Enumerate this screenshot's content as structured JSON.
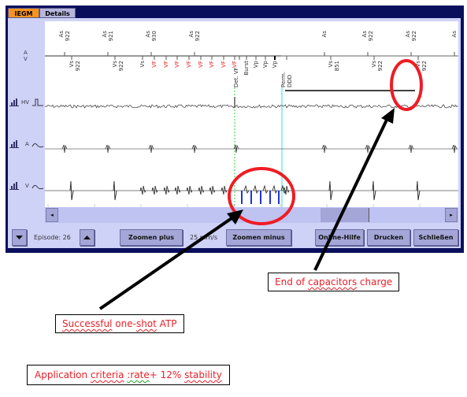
{
  "tabs": [
    {
      "label": "IEGM",
      "active": true
    },
    {
      "label": "Details",
      "active": false
    }
  ],
  "channels": {
    "marker_label_top": "A",
    "marker_label_bottom": "V",
    "traces": [
      {
        "label": "HV"
      },
      {
        "label": "A"
      },
      {
        "label": "V"
      }
    ]
  },
  "markers_atrial": [
    {
      "name": "As",
      "value": "922"
    },
    {
      "name": "As",
      "value": "921"
    },
    {
      "name": "As",
      "value": "930"
    },
    {
      "name": "As",
      "value": "922"
    },
    {
      "name": "As",
      "value": ""
    },
    {
      "name": "As",
      "value": "922"
    },
    {
      "name": "As",
      "value": "922"
    },
    {
      "name": "As",
      "value": ""
    }
  ],
  "markers_ventricular": [
    {
      "name": "Vs",
      "value": "922",
      "color": "#333333"
    },
    {
      "name": "Vs",
      "value": "922",
      "color": "#333333"
    },
    {
      "name": "Vs",
      "value": "",
      "color": "#333333"
    },
    {
      "name": "VF",
      "value": "",
      "color": "#e8202a"
    },
    {
      "name": "VF",
      "value": "",
      "color": "#e8202a"
    },
    {
      "name": "VF",
      "value": "",
      "color": "#e8202a"
    },
    {
      "name": "VF",
      "value": "",
      "color": "#e8202a"
    },
    {
      "name": "VF",
      "value": "",
      "color": "#e8202a"
    },
    {
      "name": "VF",
      "value": "",
      "color": "#e8202a"
    },
    {
      "name": "VF",
      "value": "",
      "color": "#e8202a"
    },
    {
      "name": "VF",
      "value": "",
      "color": "#e8202a"
    },
    {
      "name": "Det. VF",
      "value": "",
      "color": "#333333"
    },
    {
      "name": "Burst",
      "value": "",
      "color": "#333333"
    },
    {
      "name": "Vp",
      "value": "",
      "color": "#333333"
    },
    {
      "name": "Vp",
      "value": "",
      "color": "#333333"
    },
    {
      "name": "Vp",
      "value": "",
      "color": "#333333"
    },
    {
      "name": "Perm. DDD",
      "value": "",
      "color": "#333333"
    },
    {
      "name": "Vs",
      "value": "851",
      "color": "#333333"
    },
    {
      "name": "Vs",
      "value": "922",
      "color": "#333333"
    },
    {
      "name": "Vs",
      "value": "922",
      "color": "#333333"
    }
  ],
  "footer": {
    "episode_label": "Episode: 26",
    "zoom_plus": "Zoomen plus",
    "speed": "25 mm/s",
    "zoom_minus": "Zoomen minus",
    "help": "Online-Hilfe",
    "print": "Drucken",
    "close": "Schließen"
  },
  "scrollbar": {
    "left_arrow": "◂",
    "right_arrow": "▸"
  },
  "annotations": {
    "capacitors": {
      "pre": "End of ",
      "squig": "capacitors",
      "post": " charge"
    },
    "atp": {
      "squig1": "Successful",
      "mid": " one-",
      "squig2": "shot",
      "post": " ATP"
    },
    "criteria": {
      "pre": "Application ",
      "squig1": "criteria",
      "mid1": " ",
      "squig2": ":rate",
      "mid2": "+ 12% ",
      "squig3": "stability"
    }
  },
  "colors": {
    "frame": "#0a0f5c",
    "panel": "#cfd2f7",
    "active_tab": "#f7941d",
    "vf_marker": "#e8202a",
    "atp_pulse": "#2233dd",
    "detection_line": "#33cc33",
    "charge_end_line": "#55e6e6",
    "highlight": "#ee1c24"
  }
}
